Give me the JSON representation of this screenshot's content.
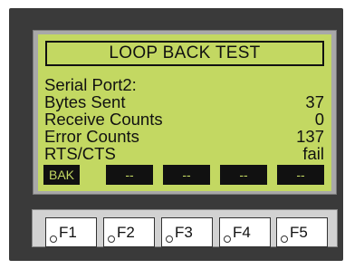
{
  "screen": {
    "title": "LOOP BACK TEST",
    "rows": [
      {
        "label": "Serial Port2:",
        "value": ""
      },
      {
        "label": "Bytes Sent",
        "value": "37"
      },
      {
        "label": "Receive Counts",
        "value": "0"
      },
      {
        "label": "Error Counts",
        "value": "137"
      },
      {
        "label": "RTS/CTS",
        "value": "fail"
      }
    ],
    "softkeys": [
      "BAK",
      "--",
      "--",
      "--",
      "--"
    ]
  },
  "keypad": {
    "keys": [
      "F1",
      "F2",
      "F3",
      "F4",
      "F5"
    ]
  },
  "colors": {
    "lcd_background": "#c3d862",
    "lcd_text": "#111111",
    "bezel": "#3a3a3a",
    "keypad_panel": "#d2d2d2"
  }
}
